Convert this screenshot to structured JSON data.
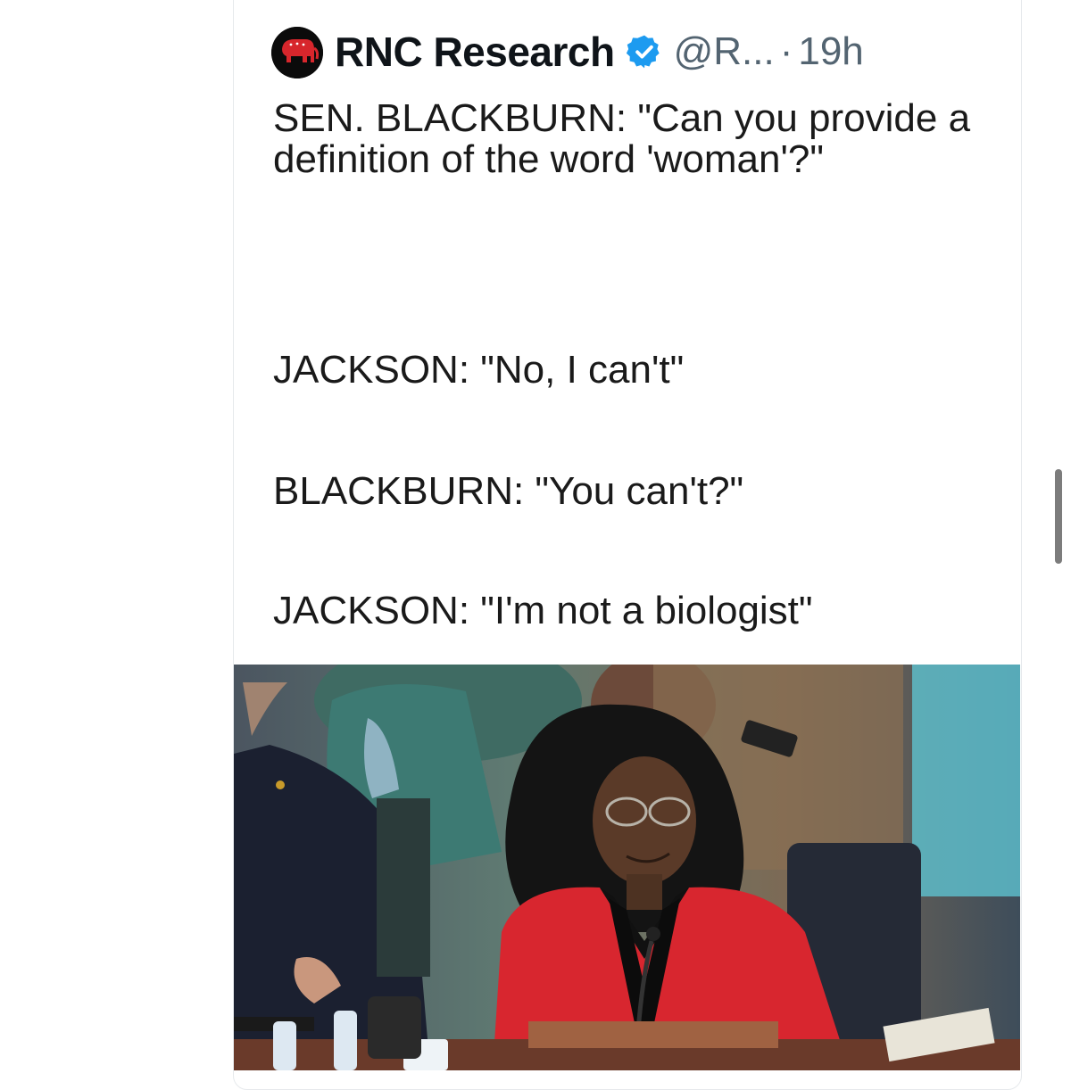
{
  "tweet": {
    "author_name": "RNC Research",
    "handle": "@R...",
    "separator": "·",
    "time": "19h",
    "verified": true,
    "avatar_icon": "republican-elephant-logo",
    "paragraphs": [
      "SEN. BLACKBURN: \"Can you provide a definition of the word 'woman'?\"",
      "JACKSON: \"No, I can't\"",
      "BLACKBURN: \"You can't?\"",
      "JACKSON: \"I'm not a biologist\""
    ]
  },
  "colors": {
    "verified_blue": "#1d9bf0",
    "logo_red": "#d7262c",
    "handle_gray": "#536471",
    "jacket_red": "#d8262f"
  },
  "media": {
    "type": "video-still",
    "icon": "hearing-photo"
  }
}
